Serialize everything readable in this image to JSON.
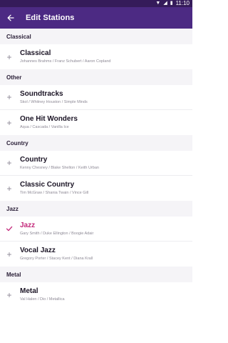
{
  "status_bar": {
    "time": "11:10",
    "icons": [
      "wifi-icon",
      "signal-icon",
      "battery-icon"
    ]
  },
  "app_bar": {
    "back_icon": "arrow-left-icon",
    "title": "Edit Stations"
  },
  "colors": {
    "status_bar": "#351b5a",
    "app_bar": "#4c2a83",
    "selected_accent": "#c3287a"
  },
  "sections": [
    {
      "header": "Classical",
      "stations": [
        {
          "name": "Classical",
          "artists": "Johannes Brahms / Franz Schubert / Aaron Copland",
          "selected": false,
          "icon": "plus-icon"
        }
      ]
    },
    {
      "header": "Other",
      "stations": [
        {
          "name": "Soundtracks",
          "artists": "Skol / Whitney Houston / Simple Minds",
          "selected": false,
          "icon": "plus-icon"
        },
        {
          "name": "One Hit Wonders",
          "artists": "Aqua / Cascada / Vanilla Ice",
          "selected": false,
          "icon": "plus-icon"
        }
      ]
    },
    {
      "header": "Country",
      "stations": [
        {
          "name": "Country",
          "artists": "Kenny Chesney / Blake Shelton / Keith Urban",
          "selected": false,
          "icon": "plus-icon"
        },
        {
          "name": "Classic Country",
          "artists": "Tim McGraw / Shania Twain / Vince Gill",
          "selected": false,
          "icon": "plus-icon"
        }
      ]
    },
    {
      "header": "Jazz",
      "stations": [
        {
          "name": "Jazz",
          "artists": "Gary Smith / Duke Ellington / Boogie Adair",
          "selected": true,
          "icon": "check-icon"
        },
        {
          "name": "Vocal Jazz",
          "artists": "Gregory Porter / Stacey Kent / Diana Krall",
          "selected": false,
          "icon": "plus-icon"
        }
      ]
    },
    {
      "header": "Metal",
      "stations": [
        {
          "name": "Metal",
          "artists": "Val Halen / Dio / Metallica",
          "selected": false,
          "icon": "plus-icon"
        }
      ]
    }
  ]
}
